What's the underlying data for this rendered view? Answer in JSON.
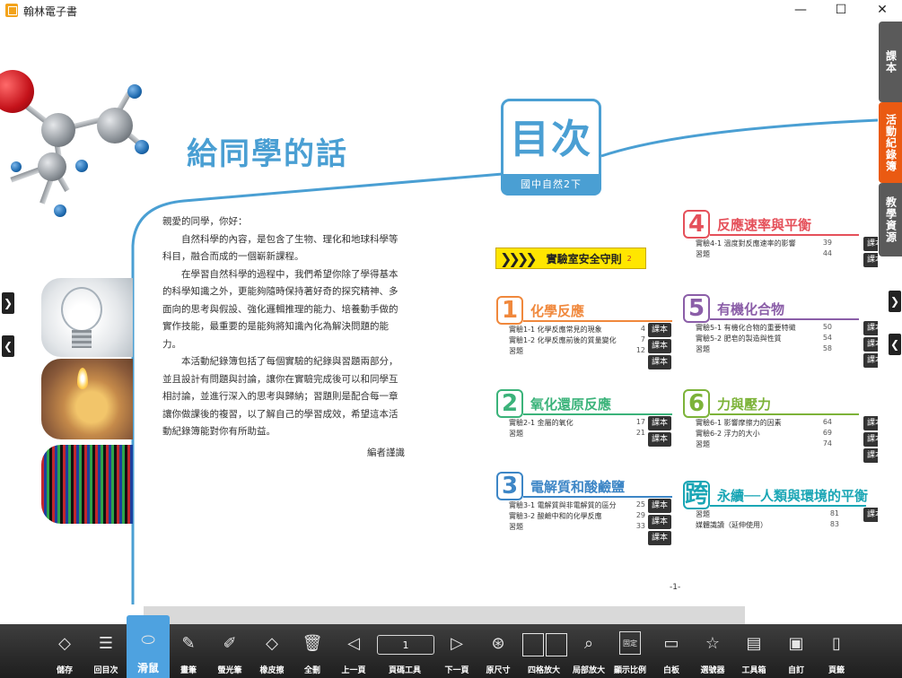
{
  "window": {
    "title": "翰林電子書",
    "minimize": "—",
    "maximize": "☐",
    "close": "✕"
  },
  "greeting": {
    "title": "給同學的話",
    "salutation": "親愛的同學，你好：",
    "p1": "自然科學的內容，是包含了生物、理化和地球科學等科目，融合而成的一個嶄新課程。",
    "p2": "在學習自然科學的過程中，我們希望你除了學得基本的科學知識之外，更能夠隨時保持著好奇的探究精神、多面向的思考與假設、強化邏輯推理的能力、培養動手做的實作技能，最重要的是能夠將知識內化為解決問題的能力。",
    "p3": "本活動紀錄簿包括了每個實驗的紀錄與習題兩部分，並且設計有問題與討論，讓你在實驗完成後可以和同學互相討論，並進行深入的思考與歸納；習題則是配合每一章讓你做課後的複習，以了解自己的學習成效，希望這本活動紀錄簿能對你有所助益。",
    "signature": "編者謹識"
  },
  "toc": {
    "title": "目次",
    "subtitle": "國中自然2下",
    "safety": {
      "label": "實驗室安全守則",
      "page": "2",
      "chevrons": "❯❯❯❯"
    },
    "button_label": "課本",
    "chapters": [
      {
        "num": "1",
        "title": "化學反應",
        "color": "#f0883c",
        "items": [
          {
            "label": "實驗1-1  化學反應常見的現象",
            "page": "4"
          },
          {
            "label": "實驗1-2  化學反應前後的質量變化",
            "page": "7"
          },
          {
            "label": "習題",
            "page": "12"
          }
        ]
      },
      {
        "num": "2",
        "title": "氧化還原反應",
        "color": "#3bb37a",
        "items": [
          {
            "label": "實驗2-1  金屬的氧化",
            "page": "17"
          },
          {
            "label": "習題",
            "page": "21"
          }
        ]
      },
      {
        "num": "3",
        "title": "電解質和酸鹼鹽",
        "color": "#3d86c6",
        "items": [
          {
            "label": "實驗3-1  電解質與非電解質的區分",
            "page": "25"
          },
          {
            "label": "實驗3-2  酸鹼中和的化學反應",
            "page": "29"
          },
          {
            "label": "習題",
            "page": "33"
          }
        ]
      },
      {
        "num": "4",
        "title": "反應速率與平衡",
        "color": "#e5505a",
        "items": [
          {
            "label": "實驗4-1  溫度對反應速率的影響",
            "page": "39"
          },
          {
            "label": "習題",
            "page": "44"
          }
        ]
      },
      {
        "num": "5",
        "title": "有機化合物",
        "color": "#8b5ea8",
        "items": [
          {
            "label": "實驗5-1  有機化合物的重要特徵",
            "page": "50"
          },
          {
            "label": "實驗5-2  肥皂的製造與性質",
            "page": "54"
          },
          {
            "label": "習題",
            "page": "58"
          }
        ]
      },
      {
        "num": "6",
        "title": "力與壓力",
        "color": "#7db339",
        "items": [
          {
            "label": "實驗6-1  影響摩擦力的因素",
            "page": "64"
          },
          {
            "label": "實驗6-2  浮力的大小",
            "page": "69"
          },
          {
            "label": "習題",
            "page": "74"
          }
        ]
      },
      {
        "num": "跨",
        "title": "永續──人類與環境的平衡",
        "color": "#1aa6b5",
        "items": [
          {
            "label": "習題",
            "page": "81"
          },
          {
            "label": "媒體識讀（延伸使用）",
            "page": "83"
          }
        ]
      }
    ]
  },
  "page_number": "-1-",
  "side_tabs": [
    {
      "label": "課本",
      "active": false
    },
    {
      "label": "活動紀錄簿",
      "active": true
    },
    {
      "label": "教學資源",
      "active": false
    }
  ],
  "arrows": {
    "right": "❯",
    "left": "❮"
  },
  "toolbar": {
    "current_page": "1",
    "tools": [
      {
        "label": "儲存",
        "icon": "save-icon",
        "glyph": "◇"
      },
      {
        "label": "回目次",
        "icon": "toc-icon",
        "glyph": "☰"
      },
      {
        "label": "滑鼠",
        "icon": "mouse-icon",
        "glyph": "⬭",
        "active": true
      },
      {
        "label": "畫筆",
        "icon": "pen-icon",
        "glyph": "✎"
      },
      {
        "label": "螢光筆",
        "icon": "highlighter-icon",
        "glyph": "✐"
      },
      {
        "label": "橡皮擦",
        "icon": "eraser-icon",
        "glyph": "◇"
      },
      {
        "label": "全刪",
        "icon": "trash-icon",
        "glyph": "🗑"
      },
      {
        "label": "上一頁",
        "icon": "prev-page-icon",
        "glyph": "◁"
      },
      {
        "label": "頁碼工具",
        "icon": "page-tool-icon",
        "glyph": ""
      },
      {
        "label": "下一頁",
        "icon": "next-page-icon",
        "glyph": "▷"
      },
      {
        "label": "原尺寸",
        "icon": "original-size-icon",
        "glyph": "⊛"
      },
      {
        "label": "四格放大",
        "icon": "four-grid-icon",
        "glyph": ""
      },
      {
        "label": "局部放大",
        "icon": "zoom-area-icon",
        "glyph": "⌕"
      },
      {
        "label": "顯示比例",
        "icon": "display-ratio-icon",
        "glyph": "固定"
      },
      {
        "label": "白板",
        "icon": "whiteboard-icon",
        "glyph": "▭"
      },
      {
        "label": "選號器",
        "icon": "number-picker-icon",
        "glyph": "☆"
      },
      {
        "label": "工具箱",
        "icon": "toolbox-icon",
        "glyph": "▤"
      },
      {
        "label": "自訂",
        "icon": "custom-icon",
        "glyph": "▣"
      },
      {
        "label": "頁籤",
        "icon": "bookmark-icon",
        "glyph": "▯"
      }
    ]
  }
}
